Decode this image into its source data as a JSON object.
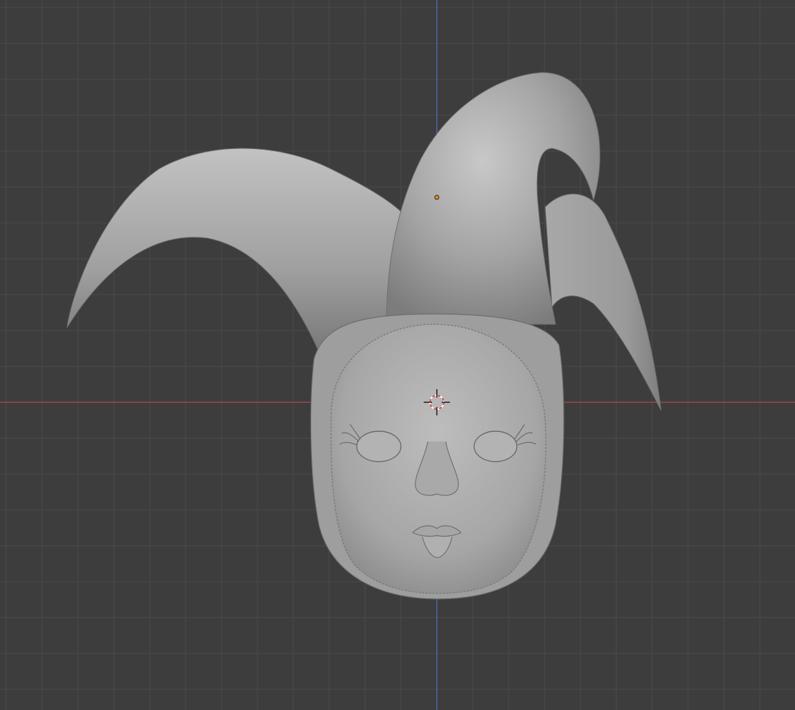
{
  "viewport": {
    "background_color": "#3d3d3d",
    "grid_color": "#4a4a4a",
    "x_axis_color": "#b8474d",
    "y_axis_color": "#4a75c4",
    "mesh_base_color": "#9b9b9b",
    "mesh_highlight_color": "#c8c8c8",
    "mesh_shadow_color": "#6a6a6a",
    "origin_color": "#e8891d",
    "cursor_ring_colors": [
      "#ffffff",
      "#d84a4a"
    ],
    "cursor_cross_color": "#111111"
  },
  "scene": {
    "object": "jester-head-sculpt",
    "icons": [
      "3d-cursor-icon",
      "object-origin-icon"
    ]
  }
}
